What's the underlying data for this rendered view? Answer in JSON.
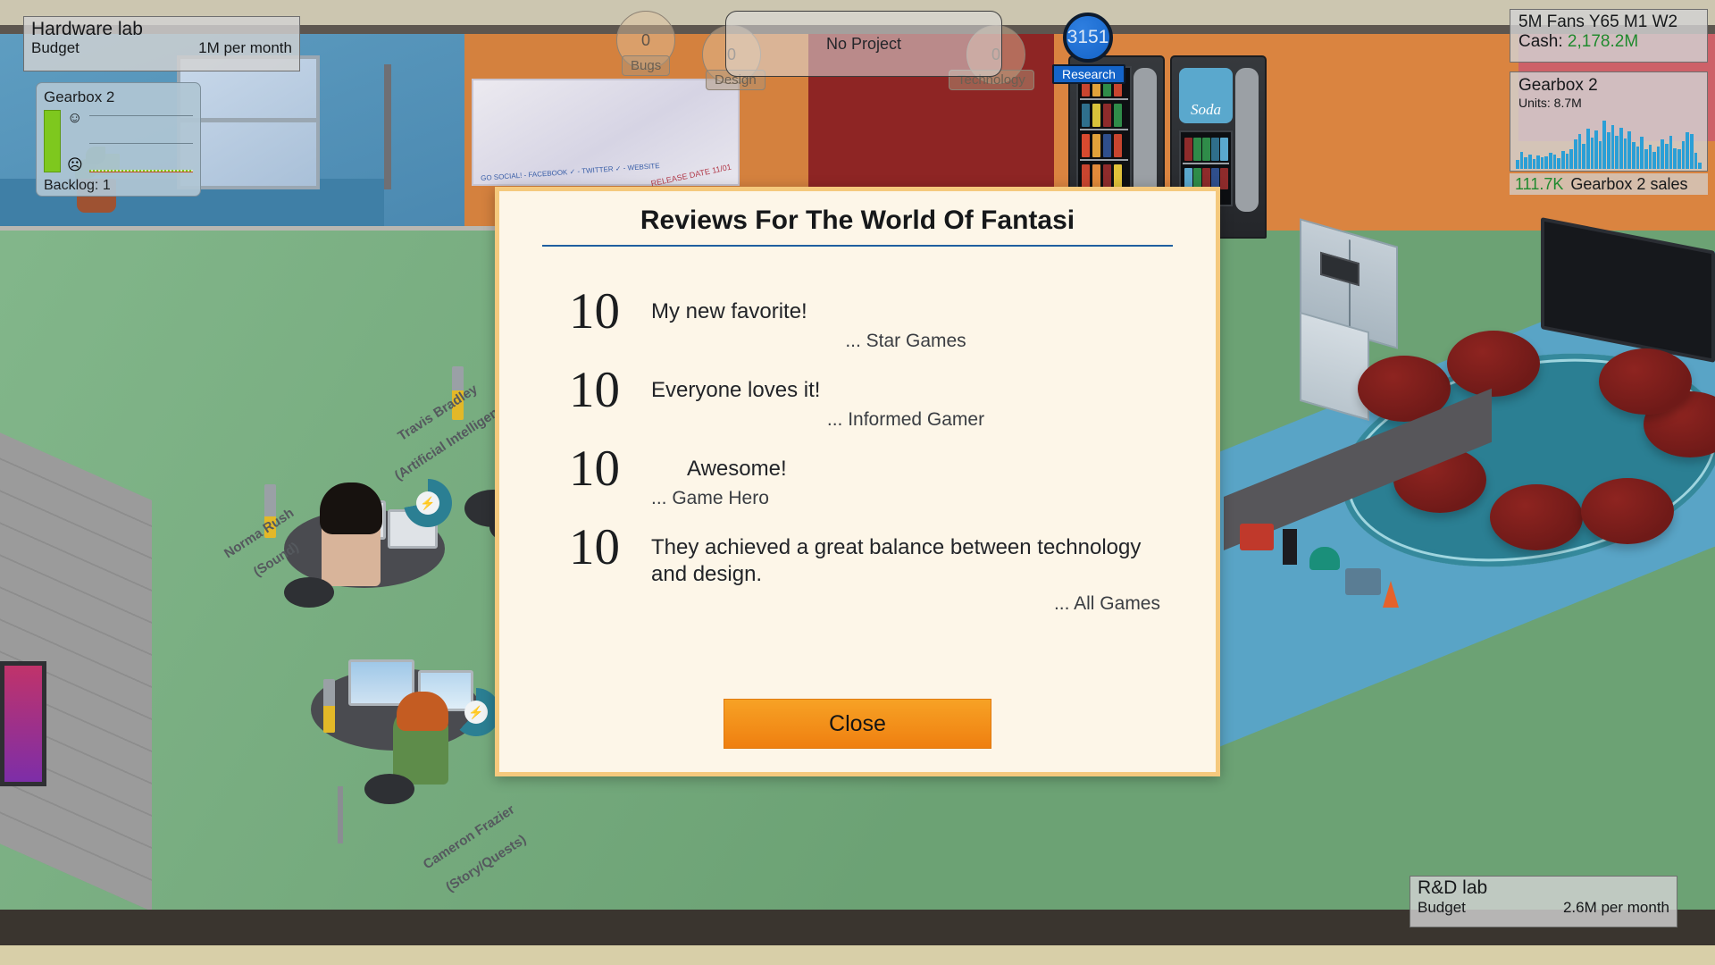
{
  "hud": {
    "hardware_lab": {
      "title": "Hardware lab",
      "budget_label": "Budget",
      "budget_value": "1M per month"
    },
    "rnd_lab": {
      "title": "R&D lab",
      "budget_label": "Budget",
      "budget_value": "2.6M per month"
    },
    "project_card": {
      "title": "Gearbox 2",
      "backlog": "Backlog: 1",
      "happy_face": "☺",
      "sad_face": "☹"
    },
    "top_project": {
      "label": "No Project"
    },
    "stats": [
      {
        "name": "Bugs",
        "value": "0"
      },
      {
        "name": "Design",
        "value": "0"
      },
      {
        "name": "Technology",
        "value": "0"
      }
    ],
    "research": {
      "points": "3151",
      "label": "Research"
    },
    "fans_panel": {
      "fans_line": "5M Fans Y65 M1 W2",
      "cash_label": "Cash:",
      "cash_value": "2,178.2M"
    },
    "sales_panel": {
      "title": "Gearbox 2",
      "units": "Units: 8.7M",
      "footer_value": "111.7K",
      "footer_label": "Gearbox 2 sales"
    }
  },
  "scene": {
    "employees": [
      {
        "name": "Norma Rush",
        "role": "(Sound)"
      },
      {
        "name": "Travis Bradley",
        "role": "(Artificial Intelligence)"
      },
      {
        "name": "Cameron Frazier",
        "role": "(Story/Quests)"
      }
    ],
    "vending": {
      "soda_label": "Soda"
    },
    "whiteboard": {
      "note_blue": "GO SOCIAL!\n- FACEBOOK ✓\n- TWITTER ✓\n- WEBSITE",
      "note_red": "RELEASE\nDATE\n11/01"
    }
  },
  "modal": {
    "title": "Reviews For The World Of Fantasi",
    "close_label": "Close",
    "reviews": [
      {
        "score": "10",
        "text": "My new favorite!",
        "author": "... Star Games",
        "align": "left",
        "author_align": "center"
      },
      {
        "score": "10",
        "text": "Everyone loves it!",
        "author": "... Informed Gamer",
        "align": "left",
        "author_align": "center"
      },
      {
        "score": "10",
        "text": "Awesome!",
        "author": "... Game Hero",
        "align": "indent",
        "author_align": "left"
      },
      {
        "score": "10",
        "text": "They achieved a great balance between technology and design.",
        "author": "... All Games",
        "align": "left",
        "author_align": "right"
      }
    ]
  },
  "chart_data": {
    "type": "bar",
    "title": "Gearbox 2",
    "ylabel": "",
    "xlabel": "",
    "values": [
      14,
      26,
      18,
      22,
      15,
      20,
      17,
      19,
      24,
      21,
      16,
      27,
      23,
      30,
      44,
      52,
      38,
      60,
      47,
      58,
      42,
      72,
      55,
      66,
      50,
      62,
      45,
      56,
      40,
      34,
      48,
      30,
      36,
      26,
      33,
      44,
      38,
      50,
      31,
      29,
      42,
      55,
      52,
      24,
      10
    ],
    "color": "#2a9fd6"
  },
  "colors": {
    "accent_orange": "#f7a225",
    "modal_bg": "#fdf6e8",
    "modal_border": "#f5c97d",
    "title_rule": "#1f5fa0",
    "cash_green": "#1f8a2e",
    "research_blue": "#1464c9",
    "chart_blue": "#2a9fd6"
  }
}
